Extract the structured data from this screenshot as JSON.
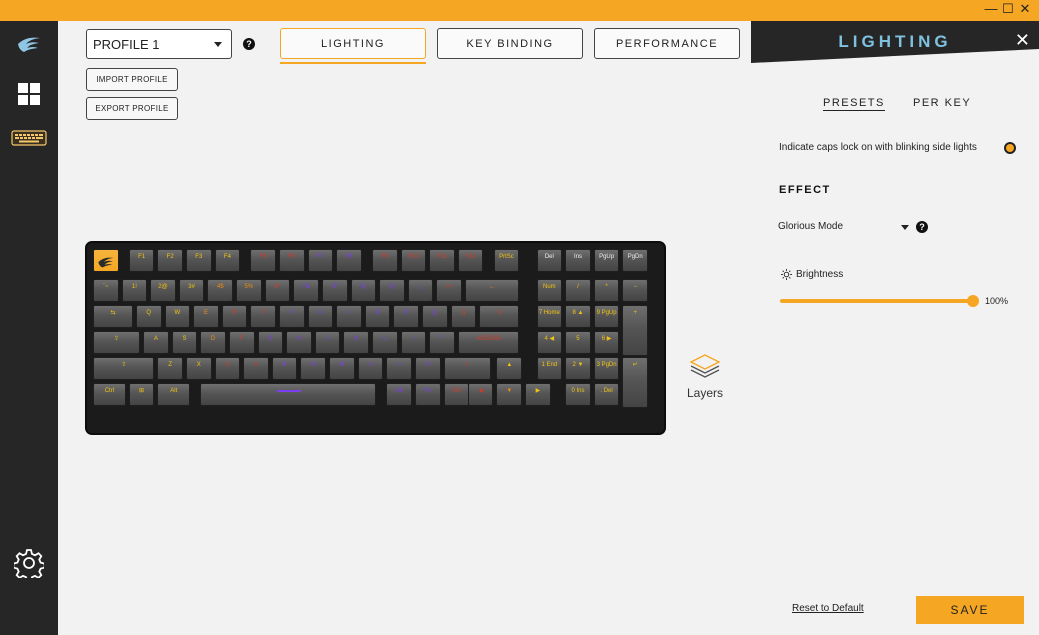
{
  "titlebar": {
    "minimize": "—",
    "maximize": "☐",
    "close": "✕"
  },
  "profile": {
    "selected": "PROFILE 1",
    "import_label": "IMPORT PROFILE",
    "export_label": "EXPORT PROFILE",
    "help": "?"
  },
  "tabs": [
    {
      "label": "LIGHTING",
      "active": true
    },
    {
      "label": "KEY BINDING",
      "active": false
    },
    {
      "label": "PERFORMANCE",
      "active": false
    }
  ],
  "keyboard": {
    "rows": [
      [
        "",
        "F1",
        "F2",
        "F3",
        "F4",
        "F5",
        "F6",
        "F7",
        "F8",
        "F9",
        "F10",
        "F11",
        "F12",
        "PrtSc",
        "Del",
        "Ins",
        "PgUp",
        "PgDn"
      ],
      [
        "`~",
        "1!",
        "2@",
        "3#",
        "4$",
        "5%",
        "6^",
        "7&",
        "8*",
        "9(",
        "0)",
        "-_",
        "=+",
        "←",
        "Num",
        "/",
        "*",
        "−"
      ],
      [
        "⇆",
        "Q",
        "W",
        "E",
        "R",
        "T",
        "Y",
        "U",
        "I",
        "O",
        "P",
        "[{",
        "]}",
        "\\|",
        "7 Home",
        "8 ▲",
        "9 PgUp",
        "+"
      ],
      [
        "⇪",
        "A",
        "S",
        "D",
        "F",
        "G",
        "H",
        "J",
        "K",
        "L",
        ";:",
        "'\"",
        "ASCEND",
        "4 ◀",
        "5",
        "6 ▶"
      ],
      [
        "⇧",
        "Z",
        "X",
        "C",
        "V",
        "B",
        "N",
        "M",
        ",<",
        ".>",
        "/?",
        "⇧",
        "▲",
        "1 End",
        "2 ▼",
        "3 PgDn",
        "↵"
      ],
      [
        "Ctrl",
        "⊞",
        "Alt",
        "",
        "Alt",
        "Fn",
        "Ctrl",
        "◀",
        "▼",
        "▶",
        "0 Ins",
        ". Del"
      ]
    ]
  },
  "layers_label": "Layers",
  "panel": {
    "title": "LIGHTING",
    "close": "✕",
    "tabs": [
      {
        "label": "PRESETS",
        "active": true
      },
      {
        "label": "PER KEY",
        "active": false
      }
    ],
    "caps_lock_text": "Indicate caps lock on with blinking side lights",
    "effect_title": "EFFECT",
    "mode": "Glorious Mode",
    "brightness_label": "Brightness",
    "brightness_value": "100%",
    "brightness_level": 1.0,
    "reset_label": "Reset to Default",
    "save_label": "SAVE"
  },
  "colors": {
    "accent": "#f5a623",
    "sidebar": "#262626",
    "title": "#7ec2e0"
  },
  "icons": [
    "logo-icon",
    "grid-icon",
    "keyboard-icon",
    "settings-gear-icon",
    "layers-icon",
    "sun-icon",
    "close-icon"
  ]
}
